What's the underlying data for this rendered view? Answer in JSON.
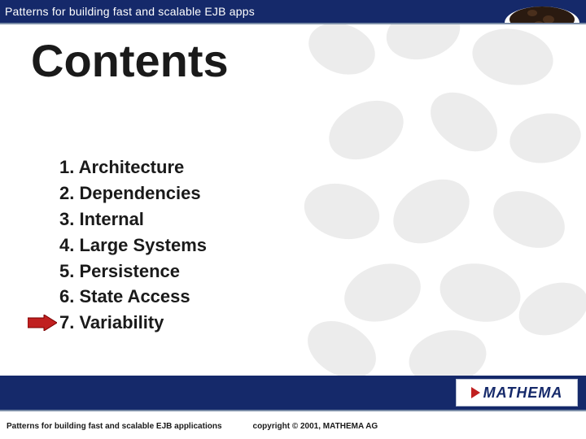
{
  "header": {
    "title": "Patterns for building fast and scalable EJB apps"
  },
  "slide": {
    "title": "Contents"
  },
  "toc": {
    "items": [
      {
        "num": "1.",
        "label": "Architecture"
      },
      {
        "num": "2.",
        "label": "Dependencies"
      },
      {
        "num": "3.",
        "label": "Internal"
      },
      {
        "num": "4.",
        "label": "Large Systems"
      },
      {
        "num": "5.",
        "label": "Persistence"
      },
      {
        "num": "6.",
        "label": "State Access"
      },
      {
        "num": "7.",
        "label": "Variability"
      }
    ],
    "current_index": 6
  },
  "footer": {
    "left": "Patterns for building fast and scalable EJB applications",
    "copyright": "copyright © 2001, MATHEMA AG",
    "logo": "MATHEMA"
  }
}
